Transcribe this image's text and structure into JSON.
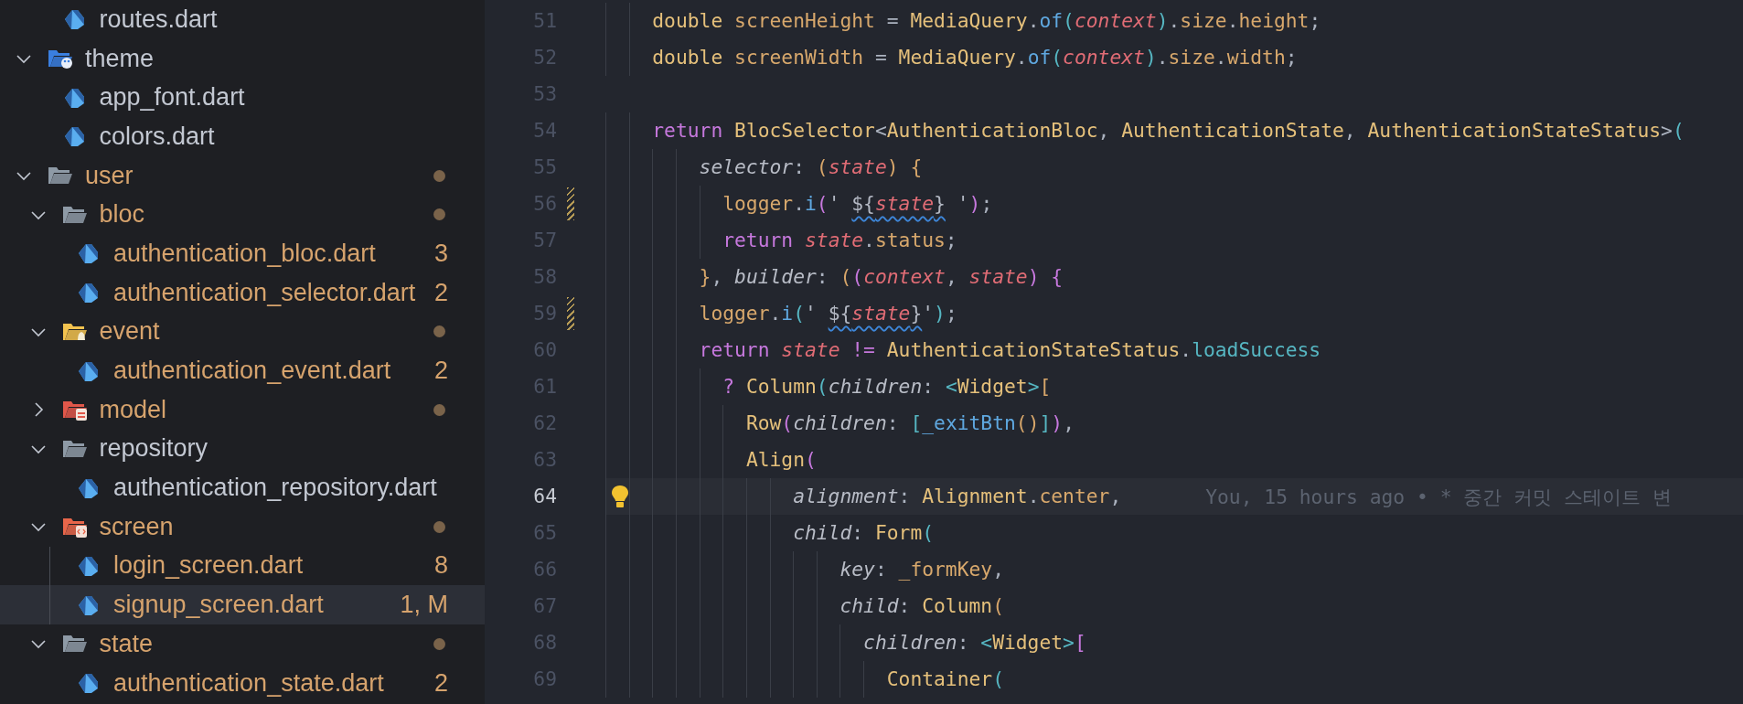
{
  "sidebar": {
    "continued_children": [
      {
        "name": "routes.dart",
        "kind": "dart",
        "modified": false,
        "selected": false
      }
    ],
    "tree": [
      {
        "name": "theme",
        "kind": "themefolder",
        "expanded": true,
        "modified": false,
        "selected": false,
        "children": [
          {
            "name": "app_font.dart",
            "kind": "dart",
            "modified": false,
            "selected": false
          },
          {
            "name": "colors.dart",
            "kind": "dart",
            "modified": false,
            "selected": false
          }
        ]
      },
      {
        "name": "user",
        "kind": "folder",
        "expanded": true,
        "modified": true,
        "selected": false,
        "children": [
          {
            "name": "bloc",
            "kind": "folder",
            "expanded": true,
            "modified": true,
            "selected": false,
            "children": [
              {
                "name": "authentication_bloc.dart",
                "kind": "dart",
                "modified": true,
                "selected": false,
                "badge": "3"
              },
              {
                "name": "authentication_selector.dart",
                "kind": "dart",
                "modified": true,
                "selected": false,
                "badge": "2"
              }
            ]
          },
          {
            "name": "event",
            "kind": "eventfolder",
            "expanded": true,
            "modified": true,
            "selected": false,
            "children": [
              {
                "name": "authentication_event.dart",
                "kind": "dart",
                "modified": true,
                "selected": false,
                "badge": "2"
              }
            ]
          },
          {
            "name": "model",
            "kind": "modelfolder",
            "expanded": false,
            "modified": true,
            "selected": false
          },
          {
            "name": "repository",
            "kind": "folder",
            "expanded": true,
            "modified": false,
            "selected": false,
            "children": [
              {
                "name": "authentication_repository.dart",
                "kind": "dart",
                "modified": false,
                "selected": false
              }
            ]
          },
          {
            "name": "screen",
            "kind": "screenfolder",
            "expanded": true,
            "modified": true,
            "selected": false,
            "children": [
              {
                "name": "login_screen.dart",
                "kind": "dart",
                "modified": true,
                "selected": false,
                "badge": "8"
              },
              {
                "name": "signup_screen.dart",
                "kind": "dart",
                "modified": true,
                "selected": true,
                "badge": "1, M"
              }
            ]
          },
          {
            "name": "state",
            "kind": "folder",
            "expanded": true,
            "modified": true,
            "selected": false,
            "children": [
              {
                "name": "authentication_state.dart",
                "kind": "dart",
                "modified": true,
                "selected": false,
                "badge": "2"
              }
            ]
          }
        ]
      }
    ]
  },
  "editor": {
    "lines": [
      {
        "number": "51",
        "current": false,
        "changed": false,
        "tokens": [
          {
            "text": "    double ",
            "kind": "type"
          },
          {
            "text": "screenHeight",
            "kind": "variable"
          },
          {
            "text": " = ",
            "kind": "punct"
          },
          {
            "text": "MediaQuery",
            "kind": "type"
          },
          {
            "text": ".",
            "kind": "punct"
          },
          {
            "text": "of",
            "kind": "method"
          },
          {
            "text": "(",
            "kind": "bracket3"
          },
          {
            "text": "context",
            "kind": "param"
          },
          {
            "text": ")",
            "kind": "bracket3"
          },
          {
            "text": ".",
            "kind": "punct"
          },
          {
            "text": "size",
            "kind": "variable"
          },
          {
            "text": ".",
            "kind": "punct"
          },
          {
            "text": "height",
            "kind": "variable"
          },
          {
            "text": ";",
            "kind": "punct"
          }
        ]
      },
      {
        "number": "52",
        "current": false,
        "changed": false,
        "tokens": [
          {
            "text": "    double ",
            "kind": "type"
          },
          {
            "text": "screenWidth",
            "kind": "variable"
          },
          {
            "text": " = ",
            "kind": "punct"
          },
          {
            "text": "MediaQuery",
            "kind": "type"
          },
          {
            "text": ".",
            "kind": "punct"
          },
          {
            "text": "of",
            "kind": "method"
          },
          {
            "text": "(",
            "kind": "bracket3"
          },
          {
            "text": "context",
            "kind": "param"
          },
          {
            "text": ")",
            "kind": "bracket3"
          },
          {
            "text": ".",
            "kind": "punct"
          },
          {
            "text": "size",
            "kind": "variable"
          },
          {
            "text": ".",
            "kind": "punct"
          },
          {
            "text": "width",
            "kind": "variable"
          },
          {
            "text": ";",
            "kind": "punct"
          }
        ]
      },
      {
        "number": "53",
        "current": false,
        "changed": false
      },
      {
        "number": "54",
        "current": false,
        "changed": false,
        "tokens": [
          {
            "text": "    return ",
            "kind": "keyword"
          },
          {
            "text": "BlocSelector",
            "kind": "type"
          },
          {
            "text": "<",
            "kind": "punct"
          },
          {
            "text": "AuthenticationBloc",
            "kind": "type"
          },
          {
            "text": ", ",
            "kind": "punct"
          },
          {
            "text": "AuthenticationState",
            "kind": "type"
          },
          {
            "text": ", ",
            "kind": "punct"
          },
          {
            "text": "AuthenticationStateStatus",
            "kind": "type"
          },
          {
            "text": ">",
            "kind": "punct"
          },
          {
            "text": "(",
            "kind": "bracket3"
          }
        ]
      },
      {
        "number": "55",
        "current": false,
        "changed": false,
        "tokens": [
          {
            "text": "        selector",
            "kind": "named"
          },
          {
            "text": ": ",
            "kind": "punct"
          },
          {
            "text": "(",
            "kind": "bracket1"
          },
          {
            "text": "state",
            "kind": "param"
          },
          {
            "text": ") {",
            "kind": "bracket1"
          }
        ]
      },
      {
        "number": "56",
        "current": false,
        "changed": true,
        "tokens": [
          {
            "text": "          logger",
            "kind": "variable"
          },
          {
            "text": ".",
            "kind": "punct"
          },
          {
            "text": "i",
            "kind": "method"
          },
          {
            "text": "(",
            "kind": "bracket2"
          },
          {
            "text": "' ",
            "kind": "string"
          },
          {
            "kind": "squiggle",
            "tokens": [
              {
                "text": "${",
                "kind": "string"
              },
              {
                "text": "state",
                "kind": "param"
              },
              {
                "text": "}",
                "kind": "string"
              }
            ]
          },
          {
            "text": " '",
            "kind": "string"
          },
          {
            "text": ")",
            "kind": "bracket2"
          },
          {
            "text": ";",
            "kind": "punct"
          }
        ]
      },
      {
        "number": "57",
        "current": false,
        "changed": false,
        "tokens": [
          {
            "text": "          return ",
            "kind": "keyword"
          },
          {
            "text": "state",
            "kind": "param"
          },
          {
            "text": ".",
            "kind": "punct"
          },
          {
            "text": "status",
            "kind": "variable"
          },
          {
            "text": ";",
            "kind": "punct"
          }
        ]
      },
      {
        "number": "58",
        "current": false,
        "changed": false,
        "tokens": [
          {
            "text": "        }",
            "kind": "bracket1"
          },
          {
            "text": ", ",
            "kind": "punct"
          },
          {
            "text": "builder",
            "kind": "named"
          },
          {
            "text": ": ",
            "kind": "punct"
          },
          {
            "text": "(",
            "kind": "bracket1"
          },
          {
            "text": "(",
            "kind": "bracket2"
          },
          {
            "text": "context",
            "kind": "param"
          },
          {
            "text": ", ",
            "kind": "punct"
          },
          {
            "text": "state",
            "kind": "param"
          },
          {
            "text": ") {",
            "kind": "bracket2"
          }
        ]
      },
      {
        "number": "59",
        "current": false,
        "changed": true,
        "tokens": [
          {
            "text": "        logger",
            "kind": "variable"
          },
          {
            "text": ".",
            "kind": "punct"
          },
          {
            "text": "i",
            "kind": "method"
          },
          {
            "text": "(",
            "kind": "bracket3"
          },
          {
            "text": "' ",
            "kind": "string"
          },
          {
            "kind": "squiggle",
            "tokens": [
              {
                "text": "${",
                "kind": "string"
              },
              {
                "text": "state",
                "kind": "param"
              },
              {
                "text": "}",
                "kind": "string"
              }
            ]
          },
          {
            "text": "'",
            "kind": "string"
          },
          {
            "text": ")",
            "kind": "bracket3"
          },
          {
            "text": ";",
            "kind": "punct"
          }
        ]
      },
      {
        "number": "60",
        "current": false,
        "changed": false,
        "tokens": [
          {
            "text": "        return ",
            "kind": "keyword"
          },
          {
            "text": "state ",
            "kind": "param"
          },
          {
            "text": "!= ",
            "kind": "operator"
          },
          {
            "text": "AuthenticationStateStatus",
            "kind": "type"
          },
          {
            "text": ".",
            "kind": "punct"
          },
          {
            "text": "loadSuccess",
            "kind": "constant"
          }
        ]
      },
      {
        "number": "61",
        "current": false,
        "changed": false,
        "tokens": [
          {
            "text": "          ? ",
            "kind": "operator"
          },
          {
            "text": "Column",
            "kind": "type"
          },
          {
            "text": "(",
            "kind": "bracket3"
          },
          {
            "text": "children",
            "kind": "named"
          },
          {
            "text": ": ",
            "kind": "punct"
          },
          {
            "text": "<",
            "kind": "angle"
          },
          {
            "text": "Widget",
            "kind": "type"
          },
          {
            "text": ">",
            "kind": "angle"
          },
          {
            "text": "[",
            "kind": "bracket1"
          }
        ]
      },
      {
        "number": "62",
        "current": false,
        "changed": false,
        "tokens": [
          {
            "text": "            Row",
            "kind": "type"
          },
          {
            "text": "(",
            "kind": "bracket2"
          },
          {
            "text": "children",
            "kind": "named"
          },
          {
            "text": ": ",
            "kind": "punct"
          },
          {
            "text": "[",
            "kind": "bracket3"
          },
          {
            "text": "_exitBtn",
            "kind": "method"
          },
          {
            "text": "()",
            "kind": "bracket1"
          },
          {
            "text": "]",
            "kind": "bracket3"
          },
          {
            "text": ")",
            "kind": "bracket2"
          },
          {
            "text": ",",
            "kind": "punct"
          }
        ]
      },
      {
        "number": "63",
        "current": false,
        "changed": false,
        "tokens": [
          {
            "text": "            Align",
            "kind": "type"
          },
          {
            "text": "(",
            "kind": "bracket2"
          }
        ]
      },
      {
        "number": "64",
        "current": true,
        "changed": false,
        "blame": "You, 15 hours ago • * 중간 커밋 스테이트 변",
        "tokens": [
          {
            "text": "                alignment",
            "kind": "named"
          },
          {
            "text": ": ",
            "kind": "punct"
          },
          {
            "text": "Alignment",
            "kind": "type"
          },
          {
            "text": ".",
            "kind": "punct"
          },
          {
            "text": "center",
            "kind": "variable"
          },
          {
            "text": ",",
            "kind": "punct"
          }
        ]
      },
      {
        "number": "65",
        "current": false,
        "changed": false,
        "tokens": [
          {
            "text": "                child",
            "kind": "named"
          },
          {
            "text": ": ",
            "kind": "punct"
          },
          {
            "text": "Form",
            "kind": "type"
          },
          {
            "text": "(",
            "kind": "bracket3"
          }
        ]
      },
      {
        "number": "66",
        "current": false,
        "changed": false,
        "tokens": [
          {
            "text": "                    key",
            "kind": "named"
          },
          {
            "text": ": ",
            "kind": "punct"
          },
          {
            "text": "_formKey",
            "kind": "variable"
          },
          {
            "text": ",",
            "kind": "punct"
          }
        ]
      },
      {
        "number": "67",
        "current": false,
        "changed": false,
        "tokens": [
          {
            "text": "                    child",
            "kind": "named"
          },
          {
            "text": ": ",
            "kind": "punct"
          },
          {
            "text": "Column",
            "kind": "type"
          },
          {
            "text": "(",
            "kind": "bracket1"
          }
        ]
      },
      {
        "number": "68",
        "current": false,
        "changed": false,
        "tokens": [
          {
            "text": "                      children",
            "kind": "named"
          },
          {
            "text": ": ",
            "kind": "punct"
          },
          {
            "text": "<",
            "kind": "angle"
          },
          {
            "text": "Widget",
            "kind": "type"
          },
          {
            "text": ">",
            "kind": "angle"
          },
          {
            "text": "[",
            "kind": "bracket2"
          }
        ]
      },
      {
        "number": "69",
        "current": false,
        "changed": false,
        "tokens": [
          {
            "text": "                        Container",
            "kind": "type"
          },
          {
            "text": "(",
            "kind": "bracket3"
          }
        ]
      }
    ]
  }
}
